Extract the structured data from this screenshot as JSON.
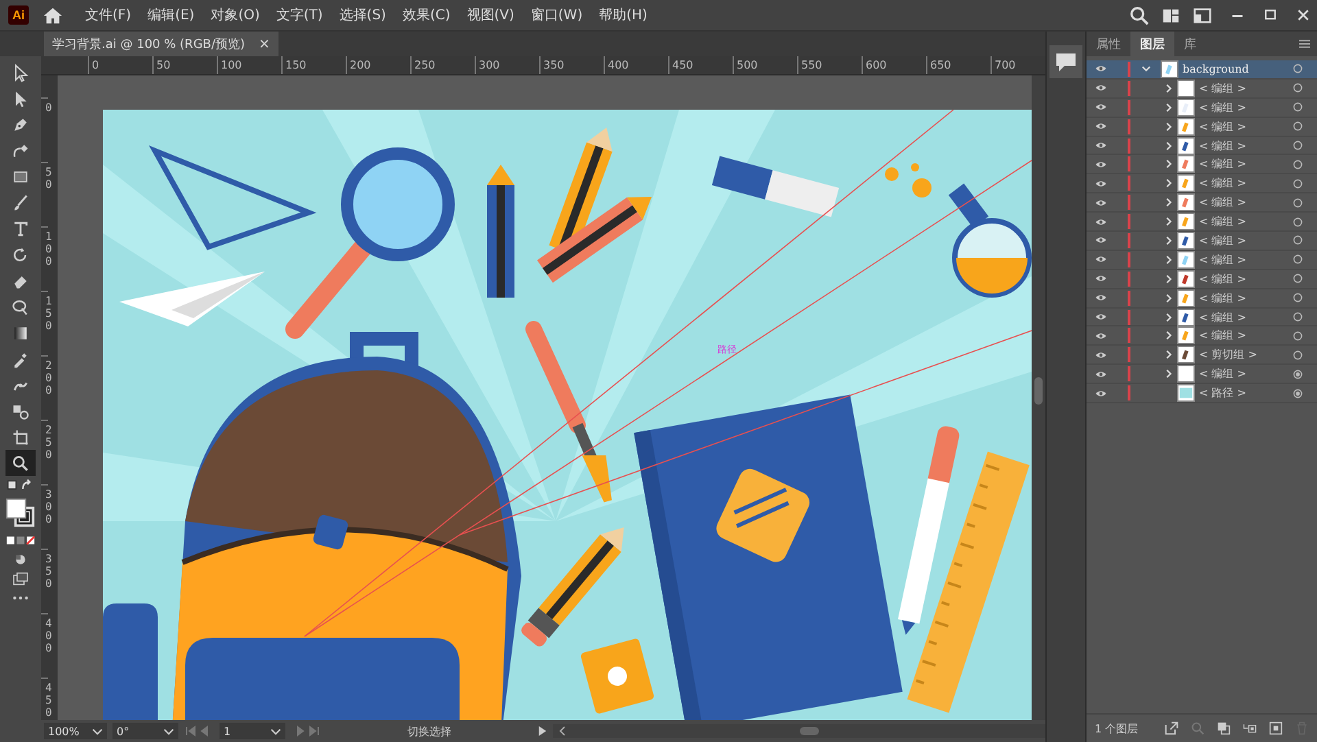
{
  "app": {
    "logo": "Ai"
  },
  "menu": [
    "文件(F)",
    "编辑(E)",
    "对象(O)",
    "文字(T)",
    "选择(S)",
    "效果(C)",
    "视图(V)",
    "窗口(W)",
    "帮助(H)"
  ],
  "document_tab": {
    "title": "学习背景.ai @ 100 % (RGB/预览)",
    "close": "×"
  },
  "tools": [
    {
      "kind": "select",
      "selected": false
    },
    {
      "kind": "direct",
      "selected": false
    },
    {
      "kind": "pen",
      "selected": false
    },
    {
      "kind": "curvature",
      "selected": false
    },
    {
      "kind": "rect",
      "selected": false
    },
    {
      "kind": "brush",
      "selected": false
    },
    {
      "kind": "type",
      "selected": false
    },
    {
      "kind": "rotate",
      "selected": false
    },
    {
      "kind": "eraser",
      "selected": false
    },
    {
      "kind": "lasso",
      "selected": false
    },
    {
      "kind": "gradient",
      "selected": false
    },
    {
      "kind": "eyedropper",
      "selected": false
    },
    {
      "kind": "puppet",
      "selected": false
    },
    {
      "kind": "blend",
      "selected": false
    },
    {
      "kind": "artboard",
      "selected": false
    },
    {
      "kind": "zoom",
      "selected": true
    }
  ],
  "rulers": {
    "horizontal": [
      "0",
      "50",
      "100",
      "150",
      "200",
      "250",
      "300",
      "350",
      "400",
      "450",
      "500",
      "550",
      "600",
      "650",
      "700"
    ],
    "vertical": [
      "0",
      "50",
      "100",
      "150",
      "200",
      "250",
      "300",
      "350",
      "400",
      "450"
    ]
  },
  "canvas": {
    "hover_label": "路径"
  },
  "status_bar": {
    "zoom": "100%",
    "rotation": "0°",
    "artboard": "1",
    "tool_name": "切换选择"
  },
  "panel": {
    "tabs": [
      {
        "label": "属性",
        "selected": false
      },
      {
        "label": "图层",
        "selected": true
      },
      {
        "label": "库",
        "selected": false
      }
    ],
    "layers": [
      {
        "name": "background",
        "kind": "layer",
        "expanded": true,
        "selected": true,
        "visible": true,
        "appearance": false,
        "children": [
          {
            "name": "< 编组 >",
            "kind": "group",
            "visible": true,
            "appearance": false
          },
          {
            "name": "< 编组 >",
            "kind": "group",
            "visible": true,
            "appearance": false
          },
          {
            "name": "< 编组 >",
            "kind": "group",
            "visible": true,
            "appearance": false
          },
          {
            "name": "< 编组 >",
            "kind": "group",
            "visible": true,
            "appearance": false
          },
          {
            "name": "< 编组 >",
            "kind": "group",
            "visible": true,
            "appearance": false
          },
          {
            "name": "< 编组 >",
            "kind": "group",
            "visible": true,
            "appearance": false
          },
          {
            "name": "< 编组 >",
            "kind": "group",
            "visible": true,
            "appearance": false
          },
          {
            "name": "< 编组 >",
            "kind": "group",
            "visible": true,
            "appearance": false
          },
          {
            "name": "< 编组 >",
            "kind": "group",
            "visible": true,
            "appearance": false
          },
          {
            "name": "< 编组 >",
            "kind": "group",
            "visible": true,
            "appearance": false
          },
          {
            "name": "< 编组 >",
            "kind": "group",
            "visible": true,
            "appearance": false
          },
          {
            "name": "< 编组 >",
            "kind": "group",
            "visible": true,
            "appearance": false
          },
          {
            "name": "< 编组 >",
            "kind": "group",
            "visible": true,
            "appearance": false
          },
          {
            "name": "< 编组 >",
            "kind": "group",
            "visible": true,
            "appearance": false
          },
          {
            "name": "< 剪切组 >",
            "kind": "group",
            "visible": true,
            "appearance": false
          },
          {
            "name": "< 编组 >",
            "kind": "group",
            "visible": true,
            "appearance": true
          },
          {
            "name": "< 路径 >",
            "kind": "path",
            "visible": true,
            "appearance": true
          }
        ]
      }
    ],
    "footer": "1 个图层"
  }
}
